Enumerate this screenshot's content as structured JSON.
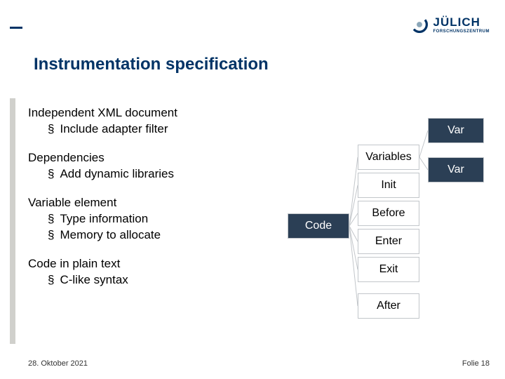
{
  "brand": {
    "name": "JÜLICH",
    "sub": "FORSCHUNGSZENTRUM"
  },
  "title": "Instrumentation specification",
  "sections": [
    {
      "head": "Independent XML document",
      "items": [
        "Include adapter filter"
      ]
    },
    {
      "head": "Dependencies",
      "items": [
        "Add dynamic libraries"
      ]
    },
    {
      "head": "Variable element",
      "items": [
        "Type information",
        "Memory to allocate"
      ]
    },
    {
      "head": "Code in plain text",
      "items": [
        "C-like syntax"
      ]
    }
  ],
  "diagram": {
    "var1": "Var",
    "variables": "Variables",
    "var2": "Var",
    "init": "Init",
    "code": "Code",
    "before": "Before",
    "enter": "Enter",
    "exit": "Exit",
    "after": "After"
  },
  "footer": {
    "date": "28. Oktober 2021",
    "page": "Folie 18"
  }
}
